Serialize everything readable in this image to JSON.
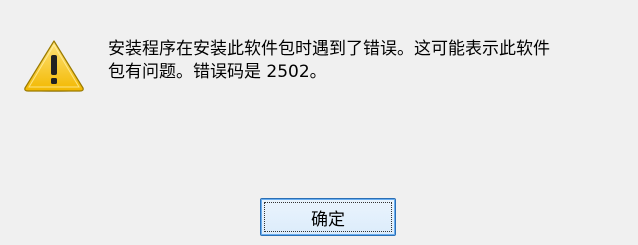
{
  "dialog": {
    "icon": "warning-triangle-icon",
    "message": "安装程序在安装此软件包时遇到了错误。这可能表示此软件\n包有问题。错误码是 2502。",
    "ok_label": "确定",
    "colors": {
      "background": "#f0f0f0",
      "warning_fill": "#f5c400",
      "button_border": "#2b6fb5"
    }
  }
}
